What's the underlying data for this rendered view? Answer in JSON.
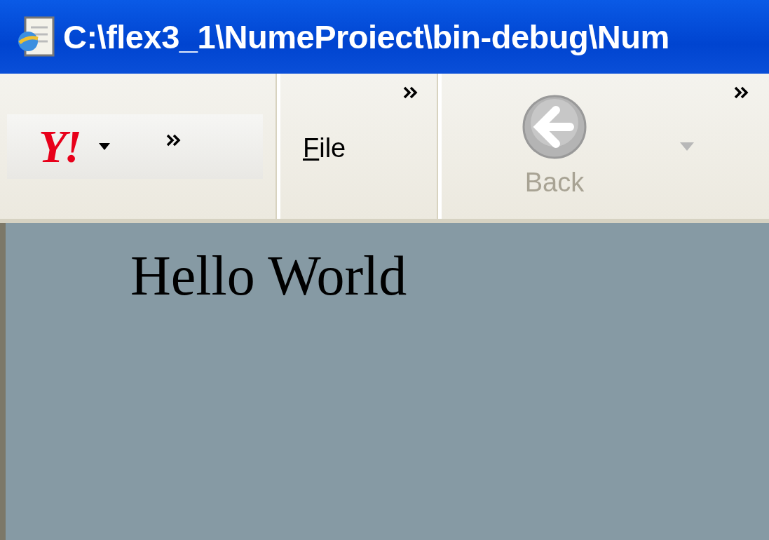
{
  "window": {
    "title": "C:\\flex3_1\\NumeProiect\\bin-debug\\Num"
  },
  "toolbar": {
    "logo": "Y!",
    "menu": [
      {
        "label": "File"
      }
    ],
    "back_button": {
      "label": "Back",
      "disabled": true
    }
  },
  "content": {
    "text": "Hello World"
  }
}
